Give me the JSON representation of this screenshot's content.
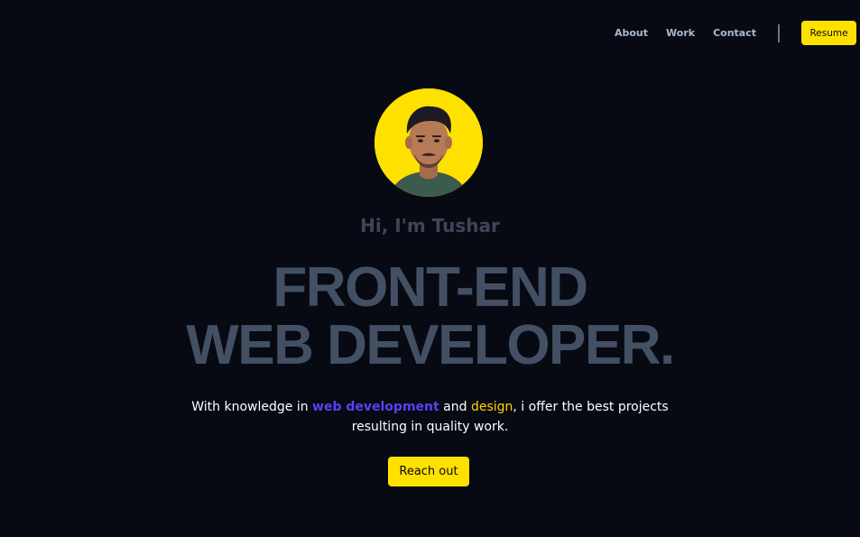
{
  "nav": {
    "links": [
      "About",
      "Work",
      "Contact"
    ],
    "resume_label": "Resume"
  },
  "hero": {
    "greeting": "Hi, I'm Tushar",
    "headline_line1": "FRONT-END",
    "headline_line2": "WEB DEVELOPER.",
    "tagline_part1": "With knowledge in ",
    "tagline_highlight1": "web development",
    "tagline_part2": " and ",
    "tagline_highlight2": "design",
    "tagline_part3": ", i offer the best projects",
    "tagline_line2": "resulting in quality work.",
    "cta_label": "Reach out"
  },
  "colors": {
    "background": "#070a12",
    "accent_yellow": "#ffe100",
    "accent_blue": "#5b3ff6",
    "headline": "#435064",
    "nav_text": "#aab8d0"
  },
  "avatar": {
    "icon": "profile-photo"
  }
}
